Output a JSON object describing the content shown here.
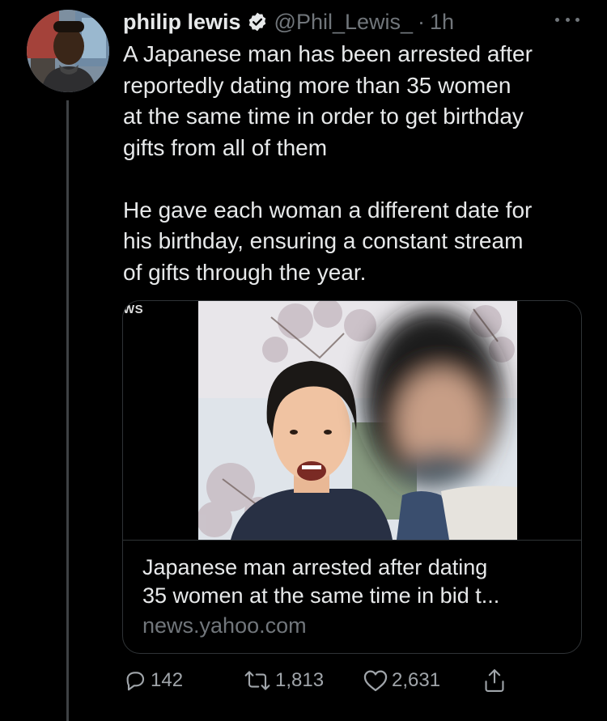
{
  "tweet": {
    "display_name": "philip lewis",
    "handle": "@Phil_Lewis_",
    "separator": "·",
    "time": "1h",
    "verified": true,
    "paragraphs": [
      "A Japanese man has been arrested after\nreportedly dating more than 35 women\nat the same time in order  to get birthday\ngifts from all of them",
      "He gave each woman a different date for\nhis birthday, ensuring a constant stream\nof gifts through the year."
    ]
  },
  "card": {
    "media_tag": "WS",
    "title": "Japanese man arrested after dating\n35 women at the same time in bid t...",
    "domain": "news.yahoo.com"
  },
  "actions": {
    "reply_count": "142",
    "retweet_count": "1,813",
    "like_count": "2,631"
  },
  "icons": {
    "verified": "verified-badge-icon",
    "more": "more-horizontal-icon",
    "reply": "reply-icon",
    "retweet": "retweet-icon",
    "like": "heart-icon",
    "share": "share-icon"
  },
  "colors": {
    "background": "#000000",
    "text": "#e7e9ea",
    "secondary": "#71767b",
    "border": "#2f3336"
  }
}
